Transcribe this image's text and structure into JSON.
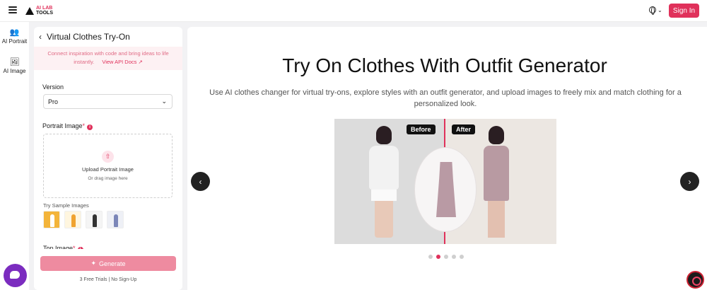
{
  "header": {
    "logo_line1": "AI LAB",
    "logo_line2": "TOOLS",
    "signin_label": "Sign In"
  },
  "rail": {
    "items": [
      {
        "label": "AI Portrait",
        "icon": "users-icon"
      },
      {
        "label": "AI Image",
        "icon": "image-icon"
      }
    ]
  },
  "panel": {
    "title": "Virtual Clothes Try-On",
    "api_line1": "Connect inspiration with code and bring ideas to life",
    "api_line2": "instantly.",
    "api_link": "View API Docs",
    "version_label": "Version",
    "version_value": "Pro",
    "portrait_label": "Portrait Image",
    "upload_title": "Upload Portrait Image",
    "upload_sub": "Or drag image here",
    "samples_label": "Try Sample Images",
    "top_image_label": "Top Image",
    "generate_label": "Generate",
    "trials_text": "3 Free Trials  |  No Sign-Up"
  },
  "main": {
    "title": "Try On Clothes With Outfit Generator",
    "description": "Use AI clothes changer for virtual try-ons, explore styles with an outfit generator, and upload images to freely mix and match clothing for a personalized look.",
    "before_tag": "Before",
    "after_tag": "After",
    "carousel_total": 5,
    "carousel_active": 2
  },
  "colors": {
    "accent": "#e0315b",
    "generate_disabled": "#ee8ba0",
    "chat_bubble": "#7b2cbf"
  }
}
